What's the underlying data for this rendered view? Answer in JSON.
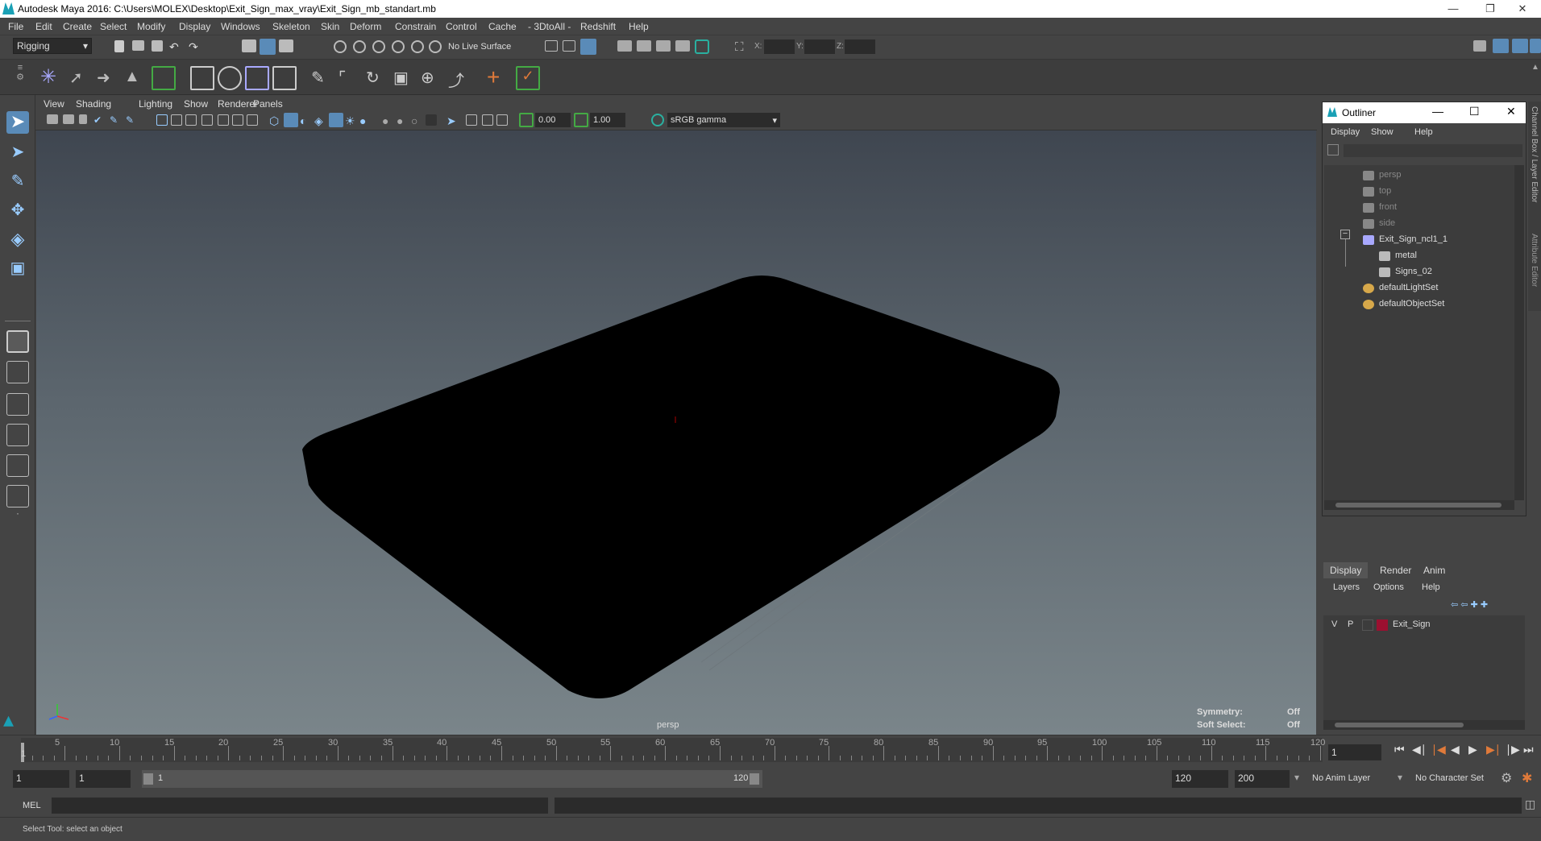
{
  "window": {
    "title": "Autodesk Maya 2016: C:\\Users\\MOLEX\\Desktop\\Exit_Sign_max_vray\\Exit_Sign_mb_standart.mb"
  },
  "menubar": [
    "File",
    "Edit",
    "Create",
    "Select",
    "Modify",
    "Display",
    "Windows",
    "Skeleton",
    "Skin",
    "Deform",
    "Constrain",
    "Control",
    "Cache",
    "- 3DtoAll -",
    "Redshift",
    "Help"
  ],
  "statusline": {
    "mode": "Rigging",
    "live_surface": "No Live Surface",
    "x_label": "X:",
    "y_label": "Y:",
    "z_label": "Z:"
  },
  "viewport": {
    "menus": [
      "View",
      "Shading",
      "Lighting",
      "Show",
      "Renderer",
      "Panels"
    ],
    "exposure": "0.00",
    "gamma": "1.00",
    "color_space": "sRGB gamma",
    "camera_label": "persp",
    "symmetry_label": "Symmetry:",
    "symmetry_value": "Off",
    "soft_select_label": "Soft Select:",
    "soft_select_value": "Off"
  },
  "outliner": {
    "title": "Outliner",
    "menus": [
      "Display",
      "Show",
      "Help"
    ],
    "items": [
      {
        "label": "persp",
        "dim": true,
        "icon": "camera-icon"
      },
      {
        "label": "top",
        "dim": true,
        "icon": "camera-icon"
      },
      {
        "label": "front",
        "dim": true,
        "icon": "camera-icon"
      },
      {
        "label": "side",
        "dim": true,
        "icon": "camera-icon"
      },
      {
        "label": "Exit_Sign_ncl1_1",
        "dim": false,
        "icon": "group-icon"
      },
      {
        "label": "metal",
        "dim": false,
        "icon": "mesh-icon"
      },
      {
        "label": "Signs_02",
        "dim": false,
        "icon": "mesh-icon"
      },
      {
        "label": "defaultLightSet",
        "dim": false,
        "icon": "set-icon"
      },
      {
        "label": "defaultObjectSet",
        "dim": false,
        "icon": "set-icon"
      }
    ]
  },
  "layers": {
    "tabs": [
      "Display",
      "Render",
      "Anim"
    ],
    "menus": [
      "Layers",
      "Options",
      "Help"
    ],
    "rows": [
      {
        "v": "V",
        "p": "P",
        "name": "Exit_Sign",
        "color": "#9b1030"
      }
    ]
  },
  "timeline": {
    "ticks": [
      "5",
      "10",
      "15",
      "20",
      "25",
      "30",
      "35",
      "40",
      "45",
      "50",
      "55",
      "60",
      "65",
      "70",
      "75",
      "80",
      "85",
      "90",
      "95",
      "100",
      "105",
      "110",
      "115",
      "120"
    ],
    "start_label": "1",
    "current_frame": "1"
  },
  "range": {
    "start": "1",
    "anim_start": "1",
    "slider_start": "1",
    "slider_end": "120",
    "end": "120",
    "anim_end": "200",
    "anim_layer": "No Anim Layer",
    "character_set": "No Character Set"
  },
  "cmdline": {
    "lang": "MEL"
  },
  "help": {
    "text": "Select Tool: select an object"
  },
  "side_tabs": {
    "channel_box": "Channel Box / Layer Editor",
    "attribute_editor": "Attribute Editor"
  }
}
